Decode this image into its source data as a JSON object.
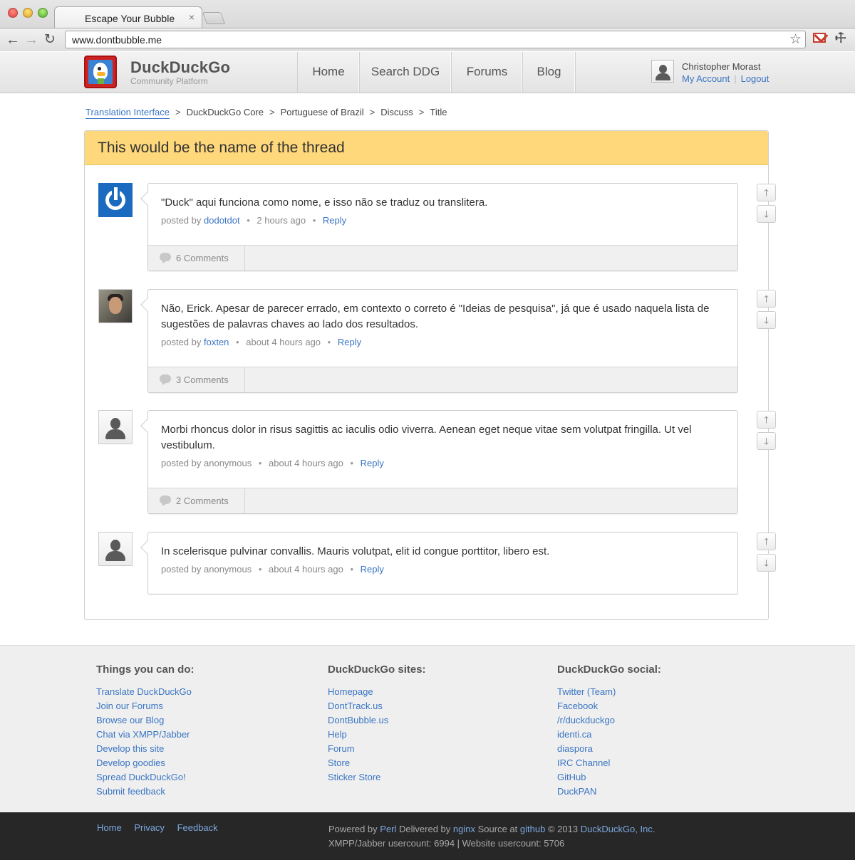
{
  "browser": {
    "tab_title": "Escape Your Bubble",
    "tab_close": "×",
    "url": "www.dontbubble.me"
  },
  "site": {
    "brand": "DuckDuckGo",
    "tagline": "Community Platform",
    "nav": [
      "Home",
      "Search DDG",
      "Forums",
      "Blog"
    ],
    "user": {
      "name": "Christopher Morast",
      "my_account": "My Account",
      "separator": "|",
      "logout": "Logout"
    }
  },
  "breadcrumb": {
    "items": [
      "Translation Interface",
      "DuckDuckGo Core",
      "Portuguese of Brazil",
      "Discuss",
      "Title"
    ],
    "separator": ">"
  },
  "thread": {
    "title": "This would be the name of the thread",
    "posts": [
      {
        "text": "\"Duck\" aqui funciona como nome, e isso não se traduz ou translitera.",
        "posted_by": "posted by",
        "author": "dodotdot",
        "time": "2 hours ago",
        "reply": "Reply",
        "comments": "6 Comments"
      },
      {
        "text": "Não, Erick. Apesar de parecer errado, em contexto o correto é \"Ideias de pesquisa\", já que é usado naquela lista de sugestões de palavras chaves ao lado dos resultados.",
        "posted_by": "posted by",
        "author": "foxten",
        "time": "about 4 hours ago",
        "reply": "Reply",
        "comments": "3 Comments"
      },
      {
        "text": "Morbi rhoncus dolor in risus sagittis ac iaculis odio viverra. Aenean eget neque vitae sem volutpat fringilla. Ut vel vestibulum.",
        "posted_by": "posted by",
        "author": "anonymous",
        "time": "about 4 hours ago",
        "reply": "Reply",
        "comments": "2 Comments"
      },
      {
        "text": "In scelerisque pulvinar convallis. Mauris volutpat, elit id congue porttitor, libero est.",
        "posted_by": "posted by",
        "author": "anonymous",
        "time": "about 4 hours ago",
        "reply": "Reply"
      }
    ],
    "meta_dot": "•",
    "vote_up": "🡑",
    "vote_down": "🡓"
  },
  "footer": {
    "col1": {
      "heading": "Things you can do:",
      "links": [
        "Translate DuckDuckGo",
        "Join our Forums",
        "Browse our Blog",
        "Chat via XMPP/Jabber",
        "Develop this site",
        "Develop goodies",
        "Spread DuckDuckGo!",
        "Submit feedback"
      ]
    },
    "col2": {
      "heading": "DuckDuckGo sites:",
      "links": [
        "Homepage",
        "DontTrack.us",
        "DontBubble.us",
        "Help",
        "Forum",
        "Store",
        "Sticker Store"
      ]
    },
    "col3": {
      "heading": "DuckDuckGo social:",
      "links": [
        "Twitter (Team)",
        "Facebook",
        "/r/duckduckgo",
        "identi.ca",
        "diaspora",
        "IRC Channel",
        "GitHub",
        "DuckPAN"
      ]
    },
    "bottom_links": [
      "Home",
      "Privacy",
      "Feedback"
    ],
    "powered_by": "Powered by",
    "perl": "Perl",
    "delivered_by": "Delivered by",
    "nginx": "nginx",
    "source_at": "Source at",
    "github": "github",
    "copyright": "© 2013",
    "company": "DuckDuckGo, Inc.",
    "stats": "XMPP/Jabber usercount: 6994 | Website usercount: 5706"
  },
  "colors": {
    "link": "#3a75c4",
    "thread_header": "#fed87a",
    "bottom_bar": "#272727"
  }
}
